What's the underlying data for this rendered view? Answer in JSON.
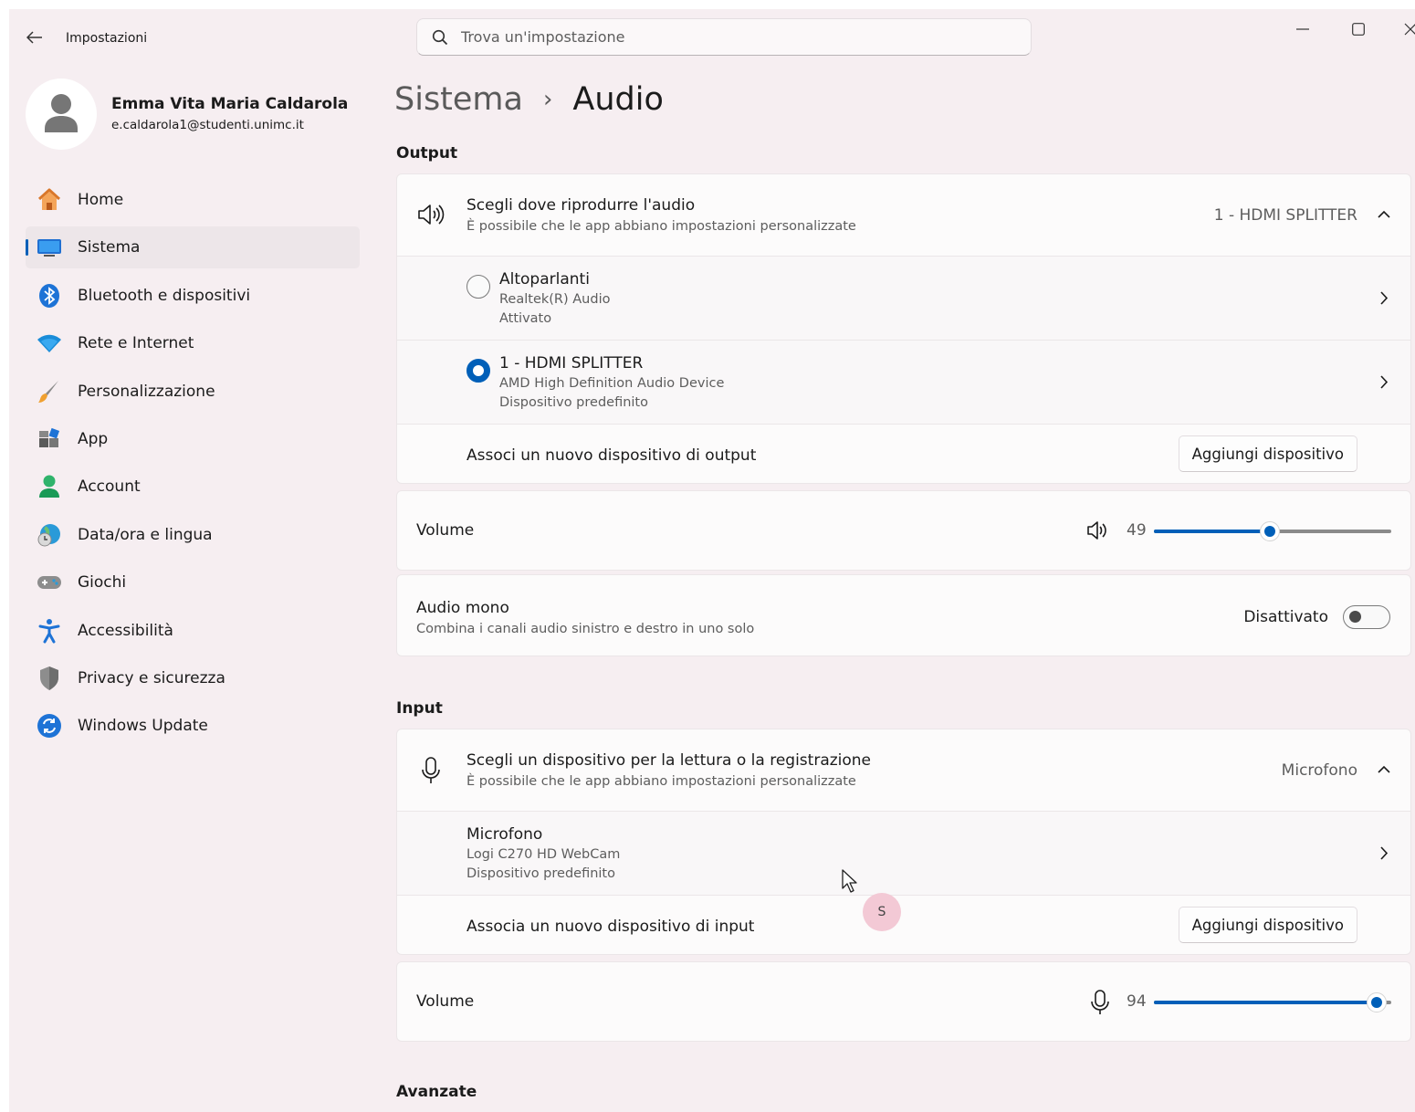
{
  "window": {
    "title": "Impostazioni"
  },
  "search": {
    "placeholder": "Trova un'impostazione"
  },
  "user": {
    "name": "Emma Vita Maria Caldarola",
    "email": "e.caldarola1@studenti.unimc.it"
  },
  "sidebar": {
    "items": [
      {
        "label": "Home",
        "icon": "home-icon"
      },
      {
        "label": "Sistema",
        "icon": "system-icon",
        "active": true
      },
      {
        "label": "Bluetooth e dispositivi",
        "icon": "bluetooth-icon"
      },
      {
        "label": "Rete e Internet",
        "icon": "wifi-icon"
      },
      {
        "label": "Personalizzazione",
        "icon": "brush-icon"
      },
      {
        "label": "App",
        "icon": "apps-icon"
      },
      {
        "label": "Account",
        "icon": "account-icon"
      },
      {
        "label": "Data/ora e lingua",
        "icon": "globe-clock-icon"
      },
      {
        "label": "Giochi",
        "icon": "gamepad-icon"
      },
      {
        "label": "Accessibilità",
        "icon": "accessibility-icon"
      },
      {
        "label": "Privacy e sicurezza",
        "icon": "shield-icon"
      },
      {
        "label": "Windows Update",
        "icon": "update-icon"
      }
    ]
  },
  "breadcrumb": {
    "parent": "Sistema",
    "separator": "›",
    "current": "Audio"
  },
  "output": {
    "section_title": "Output",
    "chooser": {
      "title": "Scegli dove riprodurre l'audio",
      "subtitle": "È possibile che le app abbiano impostazioni personalizzate",
      "selected": "1 - HDMI SPLITTER"
    },
    "devices": [
      {
        "name": "Altoparlanti",
        "driver": "Realtek(R) Audio",
        "status": "Attivato",
        "selected": false
      },
      {
        "name": "1 - HDMI SPLITTER",
        "driver": "AMD High Definition Audio Device",
        "status": "Dispositivo predefinito",
        "selected": true
      }
    ],
    "pair": {
      "label": "Associ un nuovo dispositivo di output",
      "button": "Aggiungi dispositivo"
    },
    "volume": {
      "label": "Volume",
      "value": "49",
      "level": 49
    },
    "mono": {
      "title": "Audio mono",
      "subtitle": "Combina i canali audio sinistro e destro in uno solo",
      "state": "Disattivato"
    }
  },
  "input": {
    "section_title": "Input",
    "chooser": {
      "title": "Scegli un dispositivo per la lettura o la registrazione",
      "subtitle": "È possibile che le app abbiano impostazioni personalizzate",
      "selected": "Microfono"
    },
    "devices": [
      {
        "name": "Microfono",
        "driver": "Logi C270 HD WebCam",
        "status": "Dispositivo predefinito"
      }
    ],
    "pair": {
      "label": "Associa un nuovo dispositivo di input",
      "button": "Aggiungi dispositivo"
    },
    "volume": {
      "label": "Volume",
      "value": "94",
      "level": 94
    }
  },
  "advanced": {
    "section_title": "Avanzate"
  },
  "click_marker": {
    "label": "S"
  },
  "colors": {
    "accent": "#005fb8",
    "background": "#f6eef1",
    "card": "#fcfbfb"
  }
}
